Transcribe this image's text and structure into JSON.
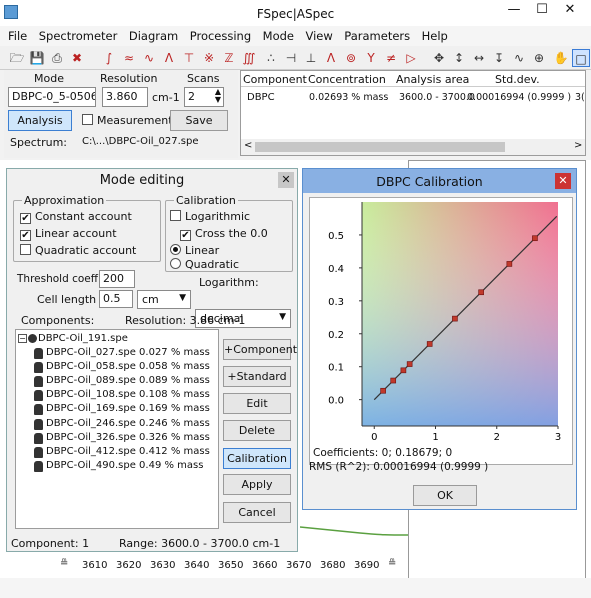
{
  "window": {
    "title": "FSpec|ASpec"
  },
  "menu": [
    "File",
    "Spectrometer",
    "Diagram",
    "Processing",
    "Mode",
    "View",
    "Parameters",
    "Help"
  ],
  "top": {
    "mode_label": "Mode",
    "resolution_label": "Resolution",
    "scans_label": "Scans",
    "mode_value": "DBPC-0_5-050619",
    "resolution_value": "3.860",
    "resolution_unit": "cm-1",
    "scans_value": "2",
    "analysis_btn": "Analysis",
    "measurement_label": "Measurement",
    "save_btn": "Save",
    "spectrum_label": "Spectrum:",
    "spectrum_value": "C:\\...\\DBPC-Oil_027.spe"
  },
  "results": {
    "headers": [
      "Component",
      "Concentration",
      "Analysis area",
      "Std.dev."
    ],
    "row": {
      "component": "DBPC",
      "concentration": "0.02693 % mass",
      "area": "3600.0 - 3700.0",
      "stddev": "0.00016994 (0.9999 )",
      "extra": "3("
    }
  },
  "mode_editing": {
    "title": "Mode editing",
    "approximation_title": "Approximation",
    "approx": [
      {
        "label": "Constant account",
        "checked": true
      },
      {
        "label": "Linear account",
        "checked": true
      },
      {
        "label": "Quadratic account",
        "checked": false
      }
    ],
    "calibration_title": "Calibration",
    "logarithmic": "Logarithmic",
    "cross_zero": "Cross the 0.0",
    "linear": "Linear",
    "quadratic": "Quadratic",
    "threshold_label": "Threshold coeff.",
    "threshold_value": "200",
    "cell_length_label": "Cell length",
    "cell_length_value": "0.5",
    "cell_unit": "cm",
    "logarithm_label": "Logarithm:",
    "logarithm_value": "decimal",
    "components_label": "Components:",
    "resolution_text": "Resolution: 3.86 cm-1",
    "tree_root": "DBPC-Oil_191.spe",
    "tree_items": [
      "DBPC-Oil_027.spe 0.027 % mass",
      "DBPC-Oil_058.spe 0.058 % mass",
      "DBPC-Oil_089.spe 0.089 % mass",
      "DBPC-Oil_108.spe 0.108 % mass",
      "DBPC-Oil_169.spe 0.169 % mass",
      "DBPC-Oil_246.spe 0.246 % mass",
      "DBPC-Oil_326.spe 0.326 % mass",
      "DBPC-Oil_412.spe 0.412 % mass",
      "DBPC-Oil_490.spe 0.49 % mass"
    ],
    "buttons": [
      "+Component",
      "+Standard",
      "Edit",
      "Delete",
      "Calibration",
      "Apply",
      "Cancel"
    ],
    "status_component": "Component: 1",
    "status_range": "Range: 3600.0 - 3700.0 cm-1"
  },
  "calibration": {
    "title": "DBPC Calibration",
    "coefficients": "Coefficients:   0;  0.18679;  0",
    "rms": "RMS (R^2): 0.00016994 (0.9999 )",
    "ok": "OK"
  },
  "chart_data": {
    "type": "scatter",
    "title": "",
    "xlabel": "",
    "ylabel": "",
    "xlim": [
      -0.2,
      3.0
    ],
    "ylim": [
      -0.08,
      0.6
    ],
    "xticks": [
      0,
      1,
      2,
      3
    ],
    "yticks": [
      0.0,
      0.1,
      0.2,
      0.3,
      0.4,
      0.5
    ],
    "points": [
      {
        "x": 0.145,
        "y": 0.027
      },
      {
        "x": 0.31,
        "y": 0.058
      },
      {
        "x": 0.476,
        "y": 0.089
      },
      {
        "x": 0.578,
        "y": 0.108
      },
      {
        "x": 0.905,
        "y": 0.169
      },
      {
        "x": 1.317,
        "y": 0.246
      },
      {
        "x": 1.745,
        "y": 0.326
      },
      {
        "x": 2.206,
        "y": 0.412
      },
      {
        "x": 2.623,
        "y": 0.49
      }
    ],
    "fit": {
      "slope": 0.18679,
      "intercept": 0
    },
    "line_color": "#333333",
    "point_color": "#c0392b"
  },
  "bg_axis": {
    "ticks": [
      "3610",
      "3620",
      "3630",
      "3640",
      "3650",
      "3660",
      "3670",
      "3680",
      "3690"
    ]
  }
}
